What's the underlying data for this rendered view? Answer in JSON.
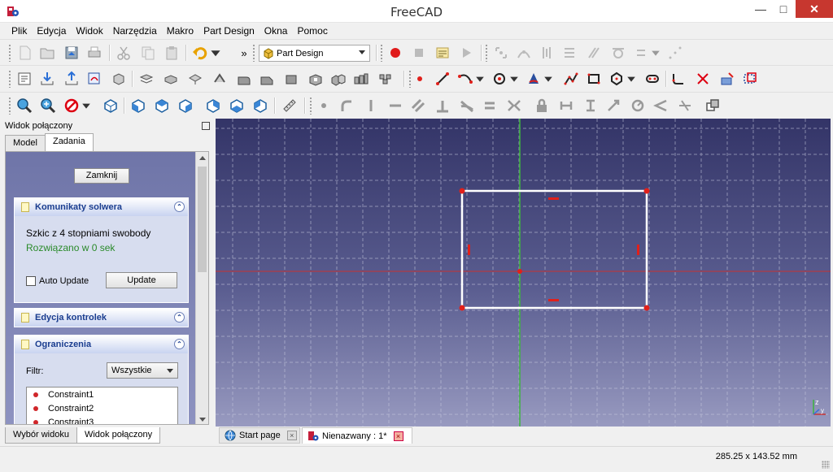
{
  "window": {
    "title": "FreeCAD"
  },
  "menu": [
    "Plik",
    "Edycja",
    "Widok",
    "Narzędzia",
    "Makro",
    "Part Design",
    "Okna",
    "Pomoc"
  ],
  "toolbar": {
    "workbench": "Part Design",
    "overflow": "»"
  },
  "panel": {
    "title": "Widok połączony",
    "tabs": [
      "Model",
      "Zadania"
    ],
    "active_tab": "Zadania",
    "bottom_tabs": [
      "Wybór widoku",
      "Widok połączony"
    ],
    "active_bottom_tab": "Widok połączony",
    "close_button": "Zamknij",
    "solver": {
      "header": "Komunikaty solwera",
      "message": "Szkic z 4 stopniami swobody",
      "status": "Rozwiązano w 0 sek",
      "auto_update_label": "Auto Update",
      "auto_update_checked": false,
      "update_button": "Update"
    },
    "edit_controls": {
      "header": "Edycja kontrolek"
    },
    "constraints": {
      "header": "Ograniczenia",
      "filter_label": "Filtr:",
      "filter_value": "Wszystkie",
      "items": [
        "Constraint1",
        "Constraint2",
        "Constraint3"
      ]
    }
  },
  "doc_tabs": [
    {
      "label": "Start page",
      "active": false
    },
    {
      "label": "Nienazwany : 1*",
      "active": true
    }
  ],
  "status": {
    "coords": "285.25 x 143.52 mm"
  },
  "colors": {
    "sketch_line": "#ffffff",
    "vertex": "#e0201b",
    "x_axis": "#c83232",
    "y_axis": "#3cb43c",
    "grid": "#c9cbe0"
  }
}
